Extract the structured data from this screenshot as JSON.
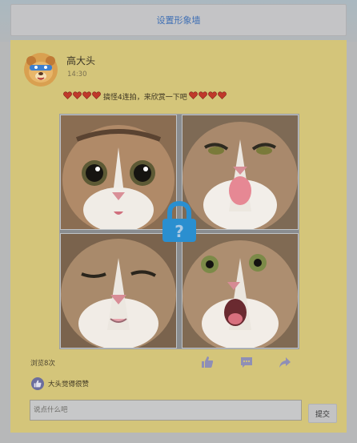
{
  "banner": {
    "label": "设置形象墙"
  },
  "post": {
    "username": "高大头",
    "time": "14:30",
    "caption": "搞怪4连拍，来欣赏一下吧",
    "hearts_before": 4,
    "hearts_after": 4,
    "photos": [
      {
        "name": "cat-wide-eyes",
        "icon": "cat-photo"
      },
      {
        "name": "cat-tongue-out",
        "icon": "cat-photo"
      },
      {
        "name": "cat-wink",
        "icon": "cat-photo"
      },
      {
        "name": "cat-open-mouth",
        "icon": "cat-photo"
      }
    ],
    "lock_icon": "lock-question-icon"
  },
  "stats": {
    "views": "浏览8次"
  },
  "actions": [
    "thumbs-up-icon",
    "comment-icon",
    "share-icon"
  ],
  "likes": {
    "text": "大头觉得很赞"
  },
  "comment": {
    "placeholder": "说点什么吧",
    "value": "",
    "submit_label": "提交"
  },
  "colors": {
    "card": "#d4c57a",
    "link": "#3f6fb4",
    "lock": "#2a8fd0",
    "action_icon": "#8f8fb6",
    "heart": "#c0392b"
  }
}
